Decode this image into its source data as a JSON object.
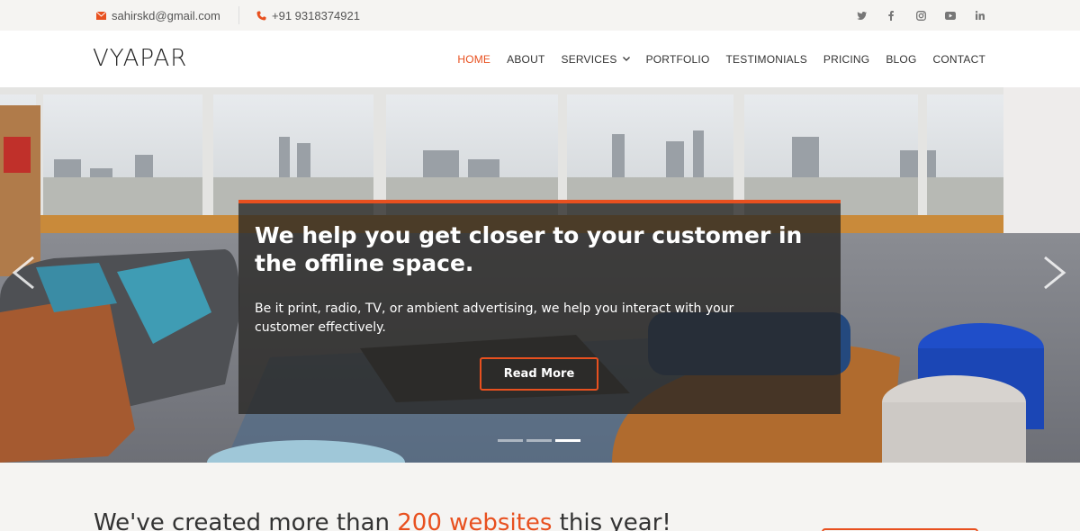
{
  "topbar": {
    "email": "sahirskd@gmail.com",
    "phone": "+91 9318374921",
    "social": [
      "twitter-icon",
      "facebook-icon",
      "instagram-icon",
      "youtube-icon",
      "linkedin-icon"
    ]
  },
  "header": {
    "logo": "VYAPAR",
    "nav": [
      {
        "label": "HOME",
        "active": true
      },
      {
        "label": "ABOUT"
      },
      {
        "label": "SERVICES",
        "dropdown": true
      },
      {
        "label": "PORTFOLIO"
      },
      {
        "label": "TESTIMONIALS"
      },
      {
        "label": "PRICING"
      },
      {
        "label": "BLOG"
      },
      {
        "label": "CONTACT"
      }
    ]
  },
  "hero": {
    "heading": "We help you get closer to your customer in the offline space.",
    "text": "Be it print, radio, TV, or ambient advertising, we help you interact with your customer effectively.",
    "button": "Read More",
    "slides": 3,
    "active_slide": 3
  },
  "section": {
    "headline_pre": "We've created more than ",
    "headline_highlight": "200 websites",
    "headline_post": " this year!"
  },
  "colors": {
    "accent": "#e8501f",
    "topbar_bg": "#f5f4f2",
    "header_bg": "#ffffff"
  }
}
